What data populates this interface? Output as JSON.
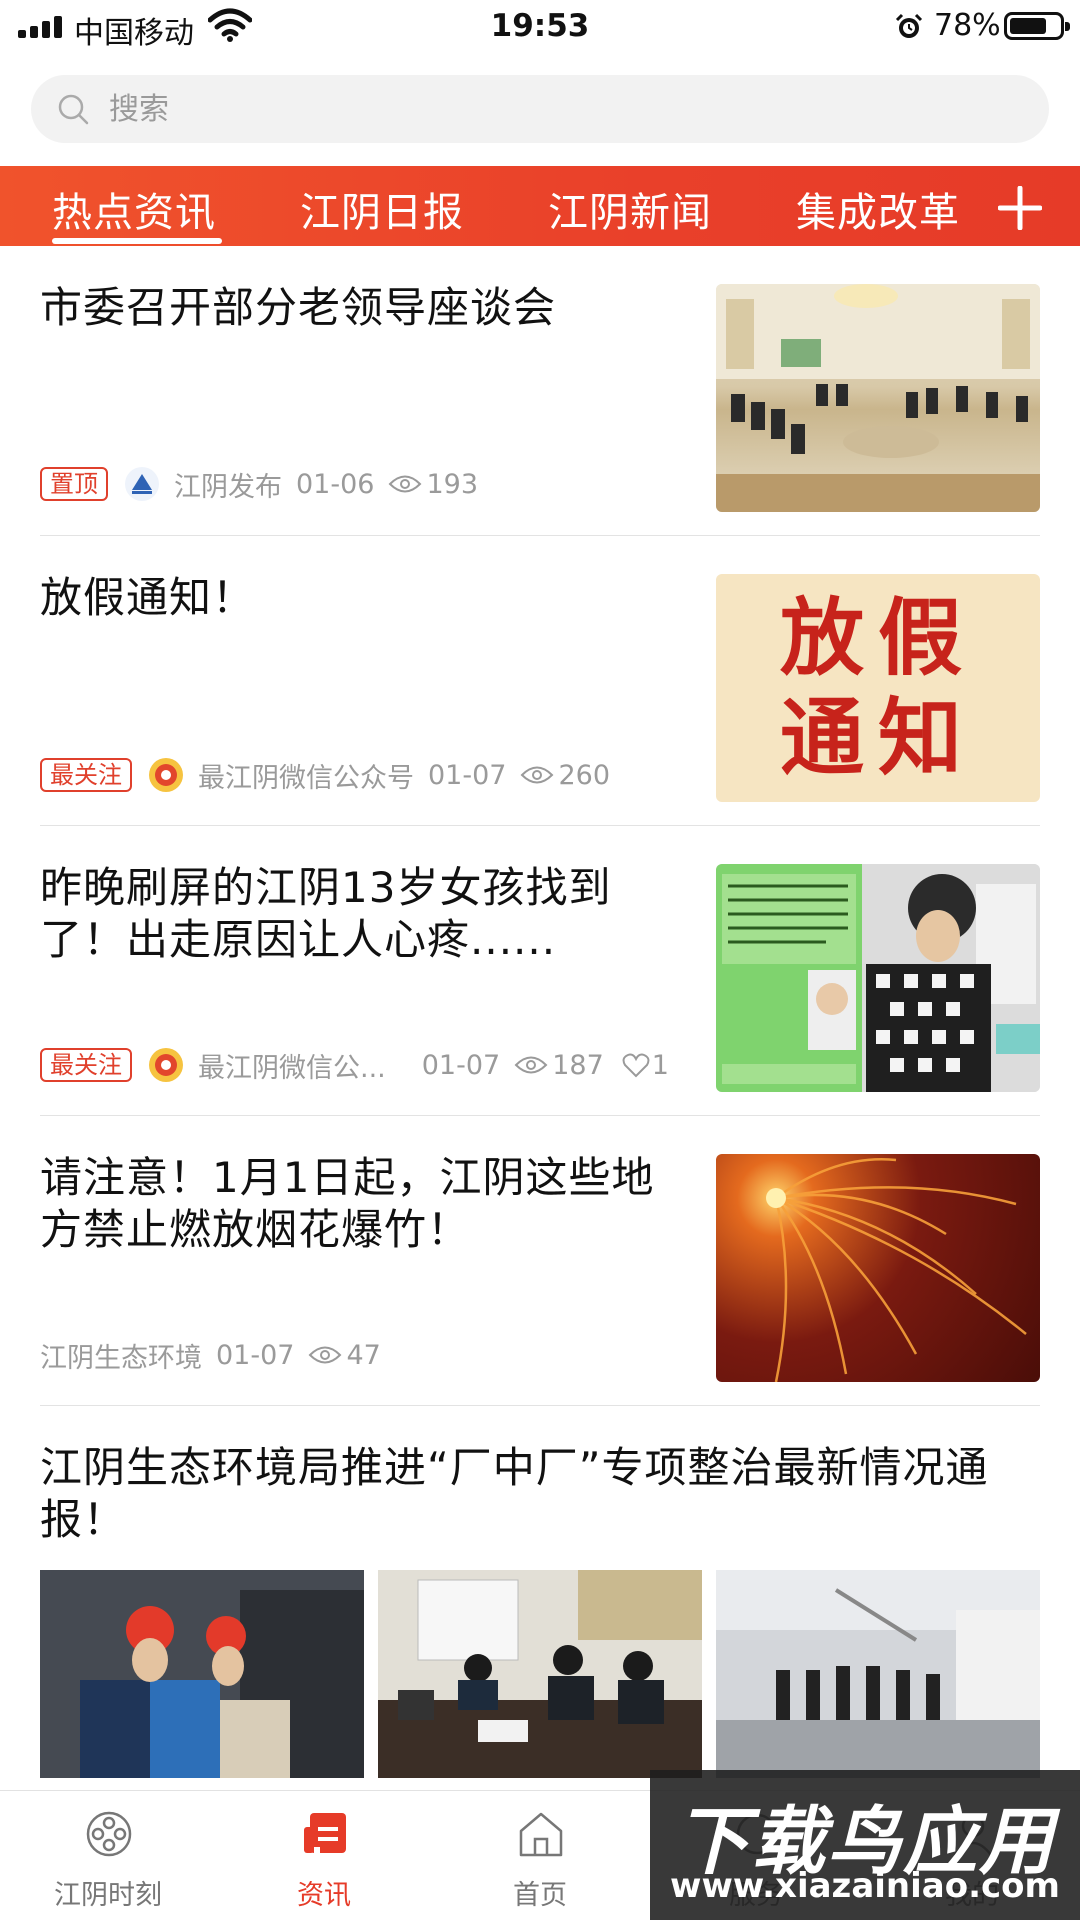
{
  "status_bar": {
    "carrier": "中国移动",
    "time": "19:53",
    "battery": "78%"
  },
  "search": {
    "placeholder": "搜索"
  },
  "tabs": [
    {
      "label": "热点资讯",
      "active": true
    },
    {
      "label": "江阴日报",
      "active": false
    },
    {
      "label": "江阴新闻",
      "active": false
    },
    {
      "label": "集成改革",
      "active": false
    }
  ],
  "feed": [
    {
      "title": "市委召开部分老领导座谈会",
      "badge": "置顶",
      "source": "江阴发布",
      "date": "01-06",
      "views": "193"
    },
    {
      "title": "放假通知！",
      "badge": "最关注",
      "source": "最江阴微信公众号",
      "date": "01-07",
      "views": "260",
      "thumb_text": [
        "放假",
        "通知"
      ]
    },
    {
      "title": "昨晚刷屏的江阴13岁女孩找到了！出走原因让人心疼......",
      "badge": "最关注",
      "source": "最江阴微信公...",
      "date": "01-07",
      "views": "187",
      "likes": "1"
    },
    {
      "title": "请注意！1月1日起，江阴这些地方禁止燃放烟花爆竹！",
      "source": "江阴生态环境",
      "date": "01-07",
      "views": "47"
    },
    {
      "title": "江阴生态环境局推进“厂中厂”专项整治最新情况通报！"
    }
  ],
  "bottom_nav": [
    {
      "label": "江阴时刻",
      "icon": "film-reel-icon"
    },
    {
      "label": "资讯",
      "icon": "news-icon",
      "active": true
    },
    {
      "label": "首页",
      "icon": "home-icon"
    },
    {
      "label": "服务",
      "icon": "service-icon"
    },
    {
      "label": "我的",
      "icon": "profile-icon"
    }
  ],
  "watermark": {
    "title": "下载鸟应用",
    "url": "www.xiazainiao.com"
  },
  "colors": {
    "accent": "#e63b28",
    "meta_gray": "#9a9a9a"
  }
}
